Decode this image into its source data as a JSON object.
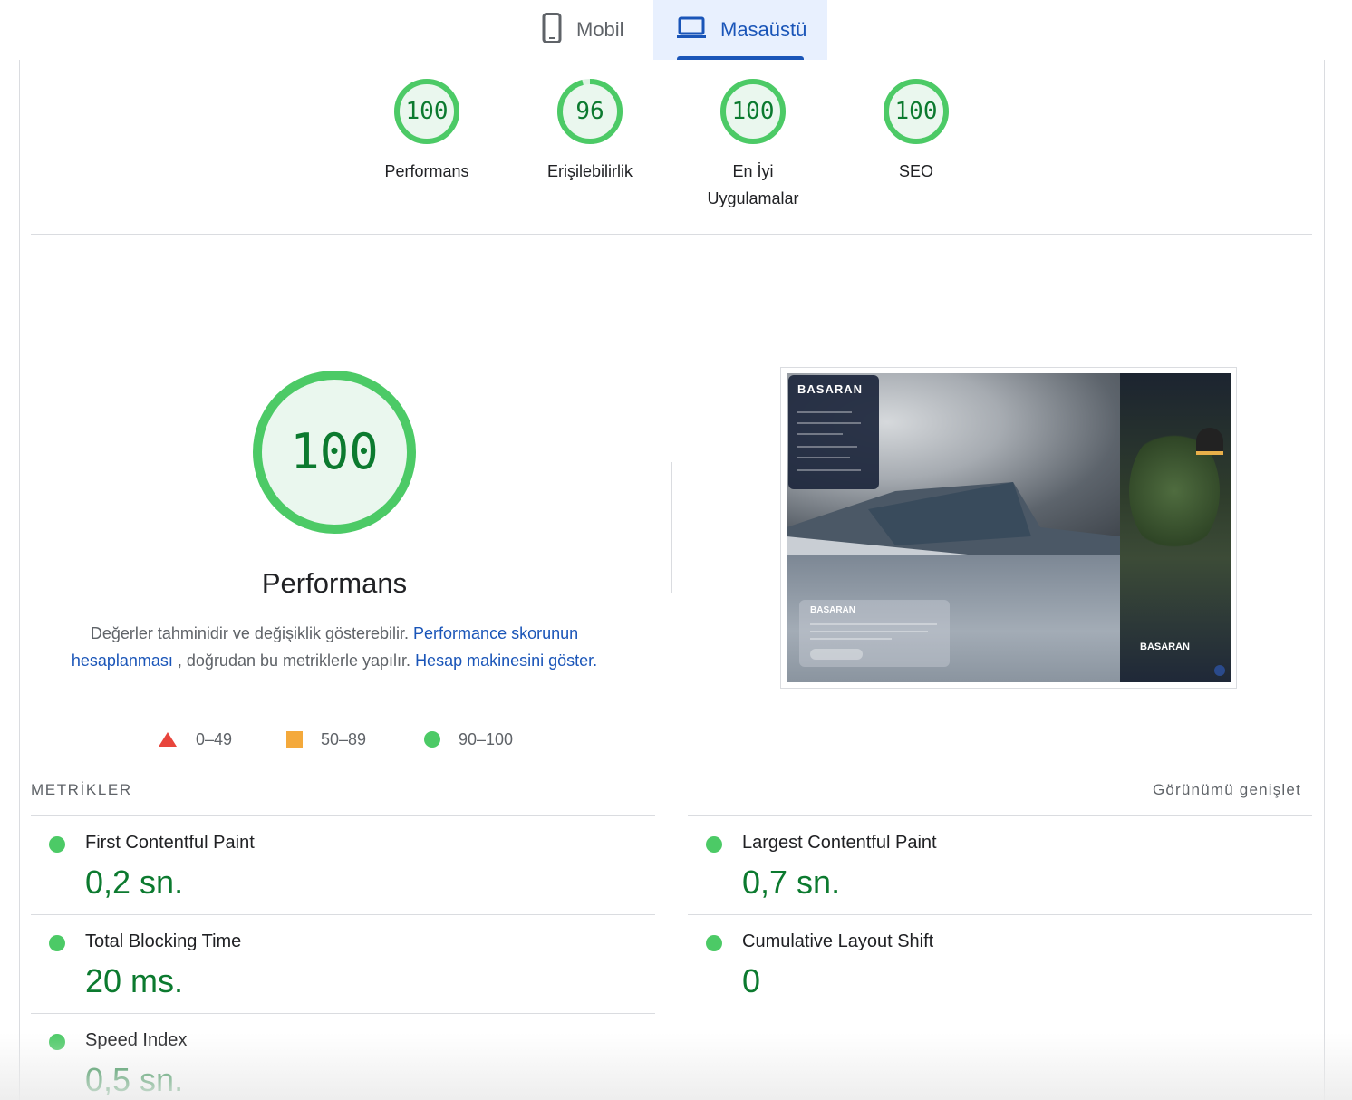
{
  "tabs": [
    {
      "label": "Mobil",
      "icon": "phone-icon",
      "selected": false
    },
    {
      "label": "Masaüstü",
      "icon": "laptop-icon",
      "selected": true
    }
  ],
  "gauges": [
    {
      "score": "100",
      "label": "Performans"
    },
    {
      "score": "96",
      "label": "Erişilebilirlik"
    },
    {
      "score": "100",
      "label": "En İyi Uygulamalar"
    },
    {
      "score": "100",
      "label": "SEO"
    }
  ],
  "performance": {
    "score": "100",
    "title": "Performans",
    "desc_text_1": "Değerler tahminidir ve değişiklik gösterebilir.",
    "desc_link_1": "Performance skorunun hesaplanması",
    "desc_text_2": ", doğrudan bu metriklerle yapılır.",
    "desc_link_2": "Hesap makinesini göster."
  },
  "legend": [
    {
      "range": "0–49",
      "shape": "triangle",
      "color": "#e8453c"
    },
    {
      "range": "50–89",
      "shape": "square",
      "color": "#f4a93b"
    },
    {
      "range": "90–100",
      "shape": "circle",
      "color": "#4cca66"
    }
  ],
  "screenshot": {
    "brand_logo": "BASARAN"
  },
  "metrics_section": {
    "title": "METRİKLER",
    "expand_label": "Görünümü genişlet"
  },
  "metrics": [
    {
      "name": "First Contentful Paint",
      "value": "0,2 sn."
    },
    {
      "name": "Largest Contentful Paint",
      "value": "0,7 sn."
    },
    {
      "name": "Total Blocking Time",
      "value": "20 ms."
    },
    {
      "name": "Cumulative Layout Shift",
      "value": "0"
    },
    {
      "name": "Speed Index",
      "value": "0,5 sn."
    }
  ],
  "colors": {
    "pass_green": "#0c7a2f",
    "gauge_ring": "#4cca66",
    "gauge_fill": "#eaf7ee",
    "accent_blue": "#1a55b8",
    "tab_selected_bg": "#e8f0fe"
  }
}
